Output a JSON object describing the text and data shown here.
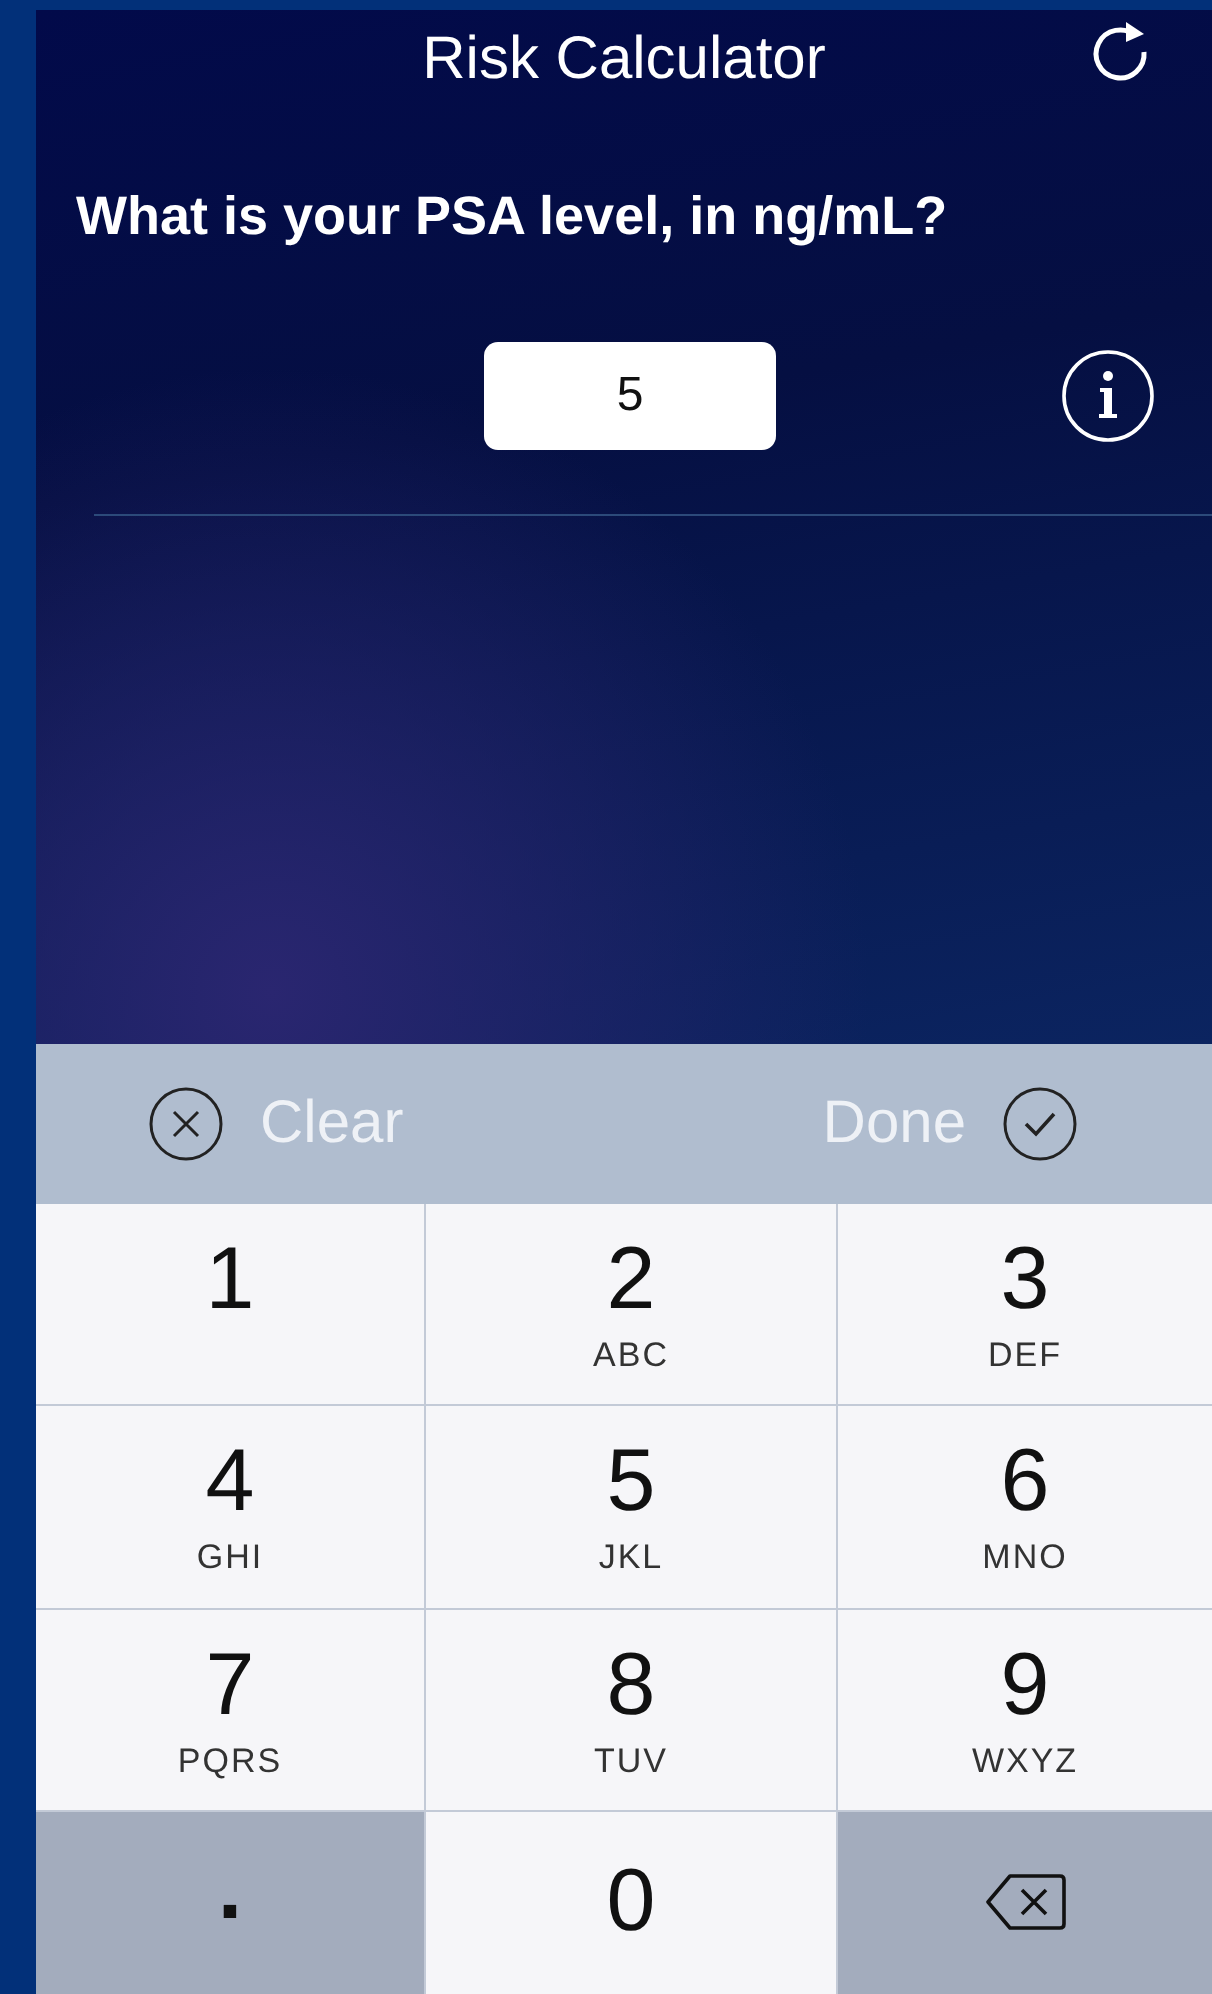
{
  "header": {
    "title": "Risk Calculator"
  },
  "question": {
    "text": "What is your PSA level, in ng/mL?",
    "value": "5"
  },
  "toolbar": {
    "clear": "Clear",
    "done": "Done"
  },
  "key_rows": [
    {
      "keys": [
        {
          "kind": "digit",
          "label": "1"
        },
        {
          "kind": "digit",
          "label": "2",
          "letters": "ABC"
        },
        {
          "kind": "digit",
          "label": "3",
          "letters": "DEF"
        }
      ]
    },
    {
      "keys": [
        {
          "kind": "digit",
          "label": "4",
          "letters": "GHI"
        },
        {
          "kind": "digit",
          "label": "5",
          "letters": "JKL"
        },
        {
          "kind": "digit",
          "label": "6",
          "letters": "MNO"
        }
      ]
    },
    {
      "keys": [
        {
          "kind": "digit",
          "label": "7",
          "letters": "PQRS"
        },
        {
          "kind": "digit",
          "label": "8",
          "letters": "TUV"
        },
        {
          "kind": "digit",
          "label": "9",
          "letters": "WXYZ"
        }
      ]
    },
    {
      "keys": [
        {
          "kind": "dot",
          "label": "."
        },
        {
          "kind": "digit",
          "label": "0"
        },
        {
          "kind": "delete"
        }
      ]
    }
  ]
}
